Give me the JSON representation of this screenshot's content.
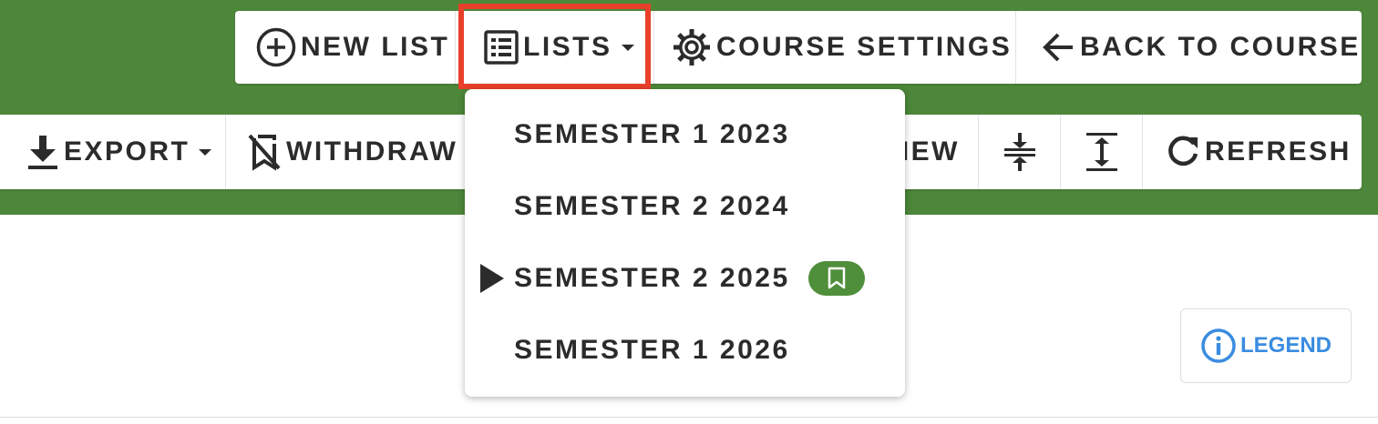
{
  "top_toolbar": {
    "new_list": "NEW LIST",
    "lists": "LISTS",
    "course_settings": "COURSE SETTINGS",
    "back_to_course": "BACK TO COURSE"
  },
  "second_toolbar": {
    "export": "EXPORT",
    "withdraw": "WITHDRAW",
    "view_partial": "IEW",
    "refresh": "REFRESH"
  },
  "lists_menu": {
    "items": [
      {
        "label": "SEMESTER 1 2023",
        "selected": false,
        "bookmarked": false
      },
      {
        "label": "SEMESTER 2 2024",
        "selected": false,
        "bookmarked": false
      },
      {
        "label": "SEMESTER 2 2025",
        "selected": true,
        "bookmarked": true
      },
      {
        "label": "SEMESTER 1 2026",
        "selected": false,
        "bookmarked": false
      }
    ]
  },
  "legend": {
    "label": "LEGEND"
  },
  "colors": {
    "header_green": "#4d873a",
    "highlight_red": "#e8402a",
    "badge_green": "#4f8f3c",
    "legend_blue": "#3a8ce0"
  },
  "icons": {
    "new_list": "plus-circle-icon",
    "lists": "list-icon",
    "course_settings": "gear-icon",
    "back_to_course": "arrow-left-icon",
    "export": "download-icon",
    "withdraw": "bookmark-off-icon",
    "compress": "compress-vertical-icon",
    "expand": "expand-vertical-icon",
    "refresh": "refresh-icon",
    "selected_item": "play-arrow-icon",
    "bookmark_badge": "bookmark-icon",
    "legend": "info-circle-icon"
  }
}
